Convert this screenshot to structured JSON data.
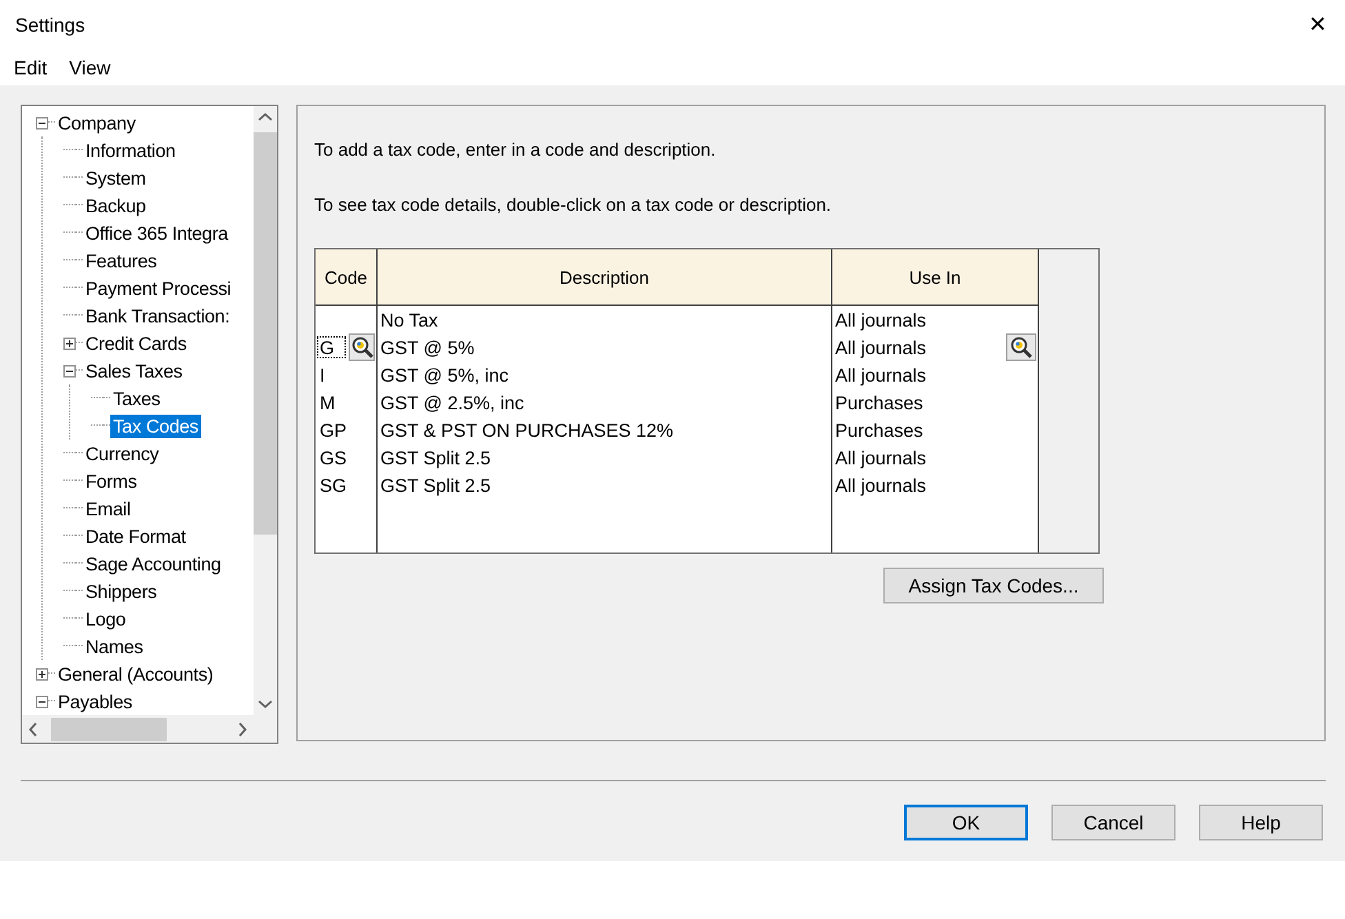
{
  "window": {
    "title": "Settings",
    "close": "✕"
  },
  "menu": [
    "Edit",
    "View"
  ],
  "tree": [
    {
      "label": "Company",
      "expanded": true,
      "selected": false,
      "children": [
        {
          "label": "Information",
          "selected": false
        },
        {
          "label": "System",
          "selected": false
        },
        {
          "label": "Backup",
          "selected": false
        },
        {
          "label": "Office 365 Integra",
          "selected": false
        },
        {
          "label": "Features",
          "selected": false
        },
        {
          "label": "Payment Processi",
          "selected": false
        },
        {
          "label": "Bank Transaction:",
          "selected": false
        },
        {
          "label": "Credit Cards",
          "expanded": false,
          "selected": false
        },
        {
          "label": "Sales Taxes",
          "expanded": true,
          "selected": false,
          "children": [
            {
              "label": "Taxes",
              "selected": false
            },
            {
              "label": "Tax Codes",
              "selected": true
            }
          ]
        },
        {
          "label": "Currency",
          "selected": false
        },
        {
          "label": "Forms",
          "selected": false
        },
        {
          "label": "Email",
          "selected": false
        },
        {
          "label": "Date Format",
          "selected": false
        },
        {
          "label": "Sage Accounting",
          "selected": false
        },
        {
          "label": "Shippers",
          "selected": false
        },
        {
          "label": "Logo",
          "selected": false
        },
        {
          "label": "Names",
          "selected": false
        }
      ]
    },
    {
      "label": "General (Accounts)",
      "expanded": false,
      "selected": false
    },
    {
      "label": "Payables",
      "expanded": true,
      "selected": false
    }
  ],
  "intro": [
    "To add a tax code, enter in a code and description.",
    "To see tax code details, double-click on a tax code or description."
  ],
  "table": {
    "columns": [
      "Code",
      "Description",
      "Use In"
    ],
    "rows": [
      {
        "code": "",
        "description": "No Tax",
        "use_in": "All journals",
        "selected": false
      },
      {
        "code": "G",
        "description": "GST @ 5%",
        "use_in": "All journals",
        "selected": true
      },
      {
        "code": "I",
        "description": "GST @ 5%, inc",
        "use_in": "All journals",
        "selected": false
      },
      {
        "code": "M",
        "description": "GST @ 2.5%, inc",
        "use_in": "Purchases",
        "selected": false
      },
      {
        "code": "GP",
        "description": "GST & PST ON PURCHASES 12%",
        "use_in": "Purchases",
        "selected": false
      },
      {
        "code": "GS",
        "description": "GST Split 2.5",
        "use_in": "All journals",
        "selected": false
      },
      {
        "code": "SG",
        "description": "GST Split 2.5",
        "use_in": "All journals",
        "selected": false
      }
    ]
  },
  "assign_button": "Assign Tax Codes...",
  "buttons": [
    {
      "label": "OK",
      "default": true
    },
    {
      "label": "Cancel",
      "default": false
    },
    {
      "label": "Help",
      "default": false
    }
  ]
}
